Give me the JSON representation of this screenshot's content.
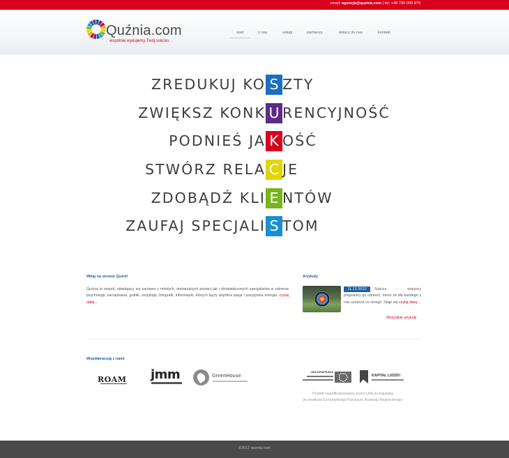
{
  "topbar": {
    "email_label": "email:",
    "email": "agencja@quznia.com",
    "separator": "|",
    "phone": "tel: +48 795 000 979"
  },
  "logo": {
    "name": "Quźnia.com",
    "tagline": "wspólnie wykujemy Twój sukces",
    "ring_colors": [
      "#1a5fa8",
      "#6a2c8c",
      "#d8001c",
      "#f2a900",
      "#f2d400",
      "#7ab51d",
      "#1aa0d8"
    ]
  },
  "nav": [
    {
      "label": "start",
      "active": true
    },
    {
      "label": "o nas",
      "active": false
    },
    {
      "label": "usługi",
      "active": false
    },
    {
      "label": "partnerzy",
      "active": false
    },
    {
      "label": "dołacz do nas",
      "active": false
    },
    {
      "label": "kontakt",
      "active": false
    }
  ],
  "acrostic": [
    {
      "before": "ZREDUKUJ KO",
      "letter": "S",
      "after": "ZTY",
      "color": "#1a6fc0"
    },
    {
      "before": "ZWIĘKSZ KONK",
      "letter": "U",
      "after": "RENCYJNOŚĆ",
      "color": "#5e2b86"
    },
    {
      "before": "PODNIEŚ JA",
      "letter": "K",
      "after": "OŚĆ",
      "color": "#d8001c"
    },
    {
      "before": "STWÓRZ RELA",
      "letter": "C",
      "after": "JE",
      "color": "#e3d500"
    },
    {
      "before": "ZDOBĄDŹ KLI",
      "letter": "E",
      "after": "NTÓW",
      "color": "#7ab51d"
    },
    {
      "before": "ZAUFAJ SPECJALI",
      "letter": "S",
      "after": "TOM",
      "color": "#1a8fd0"
    }
  ],
  "welcome": {
    "title": "Witaj na stronie Quźni!",
    "text": "Quźnia to zespół, składający się zarówno z młodych, niebanalnych postaci jak i doświadczonych specjalistów w zakresie psychologii, zarządzania, grafiki, socjologii, fotografii, informatyki, których łączy wspólna pasja i pozytywna energia.",
    "more": "czytaj dalej..."
  },
  "articles": {
    "title": "Artykuły",
    "date": "11.12.2012",
    "text": "Sukces - wszyscy pragniemy go odnieść, mimo że dla każdego z nas oznacza co innego. Staje się",
    "more": "czytaj dalej...",
    "all": "Wszystkie artykuły"
  },
  "partners": {
    "title": "Współpracują z nami",
    "roam": "ROAM",
    "jmm": "jmm",
    "greenhouse": "GreenHouse"
  },
  "eu": {
    "left_caption": "UNIA EUROPEJSKA",
    "kapital": "KAPITAŁ LUDZKI",
    "note_line1": "Projekt współfinansowany przez Unię Europejską",
    "note_line2": "ze środków Europejskiego Funduszu Rozwoju Regionalnego"
  },
  "footer": {
    "copy": "©2012 quznia.com"
  }
}
